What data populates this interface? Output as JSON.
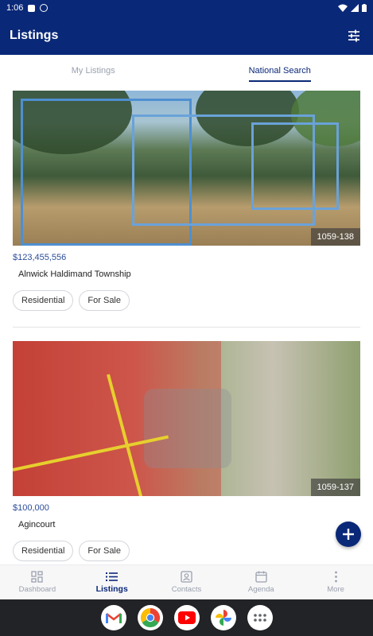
{
  "status_bar": {
    "time": "1:06"
  },
  "app_bar": {
    "title": "Listings",
    "filter_icon": "sliders-icon"
  },
  "tabs": [
    {
      "label": "My Listings",
      "active": false
    },
    {
      "label": "National Search",
      "active": true
    }
  ],
  "listings": [
    {
      "mls_number": "1059-138",
      "price": "$123,455,556",
      "address": "Alnwick Haldimand Township",
      "tags": [
        "Residential",
        "For Sale"
      ]
    },
    {
      "mls_number": "1059-137",
      "price": "$100,000",
      "address": "Agincourt",
      "tags": [
        "Residential",
        "For Sale"
      ]
    }
  ],
  "bottom_nav": [
    {
      "label": "Dashboard",
      "icon": "dashboard-icon",
      "active": false
    },
    {
      "label": "Listings",
      "icon": "list-icon",
      "active": true
    },
    {
      "label": "Contacts",
      "icon": "contact-card-icon",
      "active": false
    },
    {
      "label": "Agenda",
      "icon": "calendar-icon",
      "active": false
    },
    {
      "label": "More",
      "icon": "more-vertical-icon",
      "active": false
    }
  ],
  "dock": [
    "gmail-icon",
    "chrome-icon",
    "youtube-icon",
    "photos-icon",
    "app-drawer-icon"
  ],
  "colors": {
    "primary": "#0a2878",
    "price": "#2c4d9a",
    "muted": "#9aa0ad"
  }
}
